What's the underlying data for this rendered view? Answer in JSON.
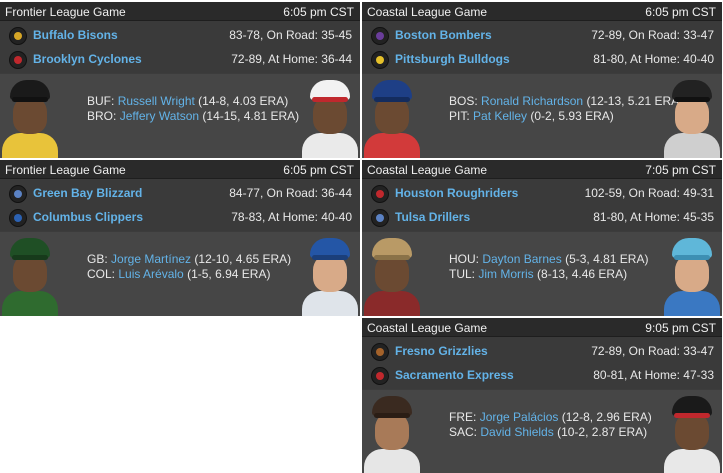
{
  "games": [
    {
      "league": "Frontier League Game",
      "time": "6:05 pm CST",
      "away": {
        "name": "Buffalo Bisons",
        "record": "83-78, On Road: 35-45",
        "logo_icon": "bisons-logo-icon"
      },
      "home": {
        "name": "Brooklyn Cyclones",
        "record": "72-89, At Home: 36-44",
        "logo_icon": "cyclones-logo-icon"
      },
      "away_pitcher": {
        "abbr": "BUF:",
        "name": "Russell Wright",
        "stats": "(14-8, 4.03 ERA)"
      },
      "home_pitcher": {
        "abbr": "BRO:",
        "name": "Jeffery Watson",
        "stats": "(14-15, 4.81 ERA)"
      }
    },
    {
      "league": "Coastal League Game",
      "time": "6:05 pm CST",
      "away": {
        "name": "Boston Bombers",
        "record": "72-89, On Road: 33-47",
        "logo_icon": "bombers-logo-icon"
      },
      "home": {
        "name": "Pittsburgh Bulldogs",
        "record": "81-80, At Home: 40-40",
        "logo_icon": "bulldogs-logo-icon"
      },
      "away_pitcher": {
        "abbr": "BOS:",
        "name": "Ronald Richardson",
        "stats": "(12-13, 5.21 ERA)"
      },
      "home_pitcher": {
        "abbr": "PIT:",
        "name": "Pat Kelley",
        "stats": "(0-2, 5.93 ERA)"
      }
    },
    {
      "league": "Frontier League Game",
      "time": "6:05 pm CST",
      "away": {
        "name": "Green Bay Blizzard",
        "record": "84-77, On Road: 36-44",
        "logo_icon": "blizzard-logo-icon"
      },
      "home": {
        "name": "Columbus Clippers",
        "record": "78-83, At Home: 40-40",
        "logo_icon": "clippers-logo-icon"
      },
      "away_pitcher": {
        "abbr": "GB:",
        "name": "Jorge Martínez",
        "stats": "(12-10, 4.65 ERA)"
      },
      "home_pitcher": {
        "abbr": "COL:",
        "name": "Luis Arévalo",
        "stats": "(1-5, 6.94 ERA)"
      }
    },
    {
      "league": "Coastal League Game",
      "time": "7:05 pm CST",
      "away": {
        "name": "Houston Roughriders",
        "record": "102-59, On Road: 49-31",
        "logo_icon": "roughriders-logo-icon"
      },
      "home": {
        "name": "Tulsa Drillers",
        "record": "81-80, At Home: 45-35",
        "logo_icon": "drillers-logo-icon"
      },
      "away_pitcher": {
        "abbr": "HOU:",
        "name": "Dayton Barnes",
        "stats": "(5-3, 4.81 ERA)"
      },
      "home_pitcher": {
        "abbr": "TUL:",
        "name": "Jim Morris",
        "stats": "(8-13, 4.46 ERA)"
      }
    },
    {
      "league": "Coastal League Game",
      "time": "9:05 pm CST",
      "away": {
        "name": "Fresno Grizzlies",
        "record": "72-89, On Road: 33-47",
        "logo_icon": "grizzlies-logo-icon"
      },
      "home": {
        "name": "Sacramento Express",
        "record": "80-81, At Home: 47-33",
        "logo_icon": "express-logo-icon"
      },
      "away_pitcher": {
        "abbr": "FRE:",
        "name": "Jorge Palácios",
        "stats": "(12-8, 2.96 ERA)"
      },
      "home_pitcher": {
        "abbr": "SAC:",
        "name": "David Shields",
        "stats": "(10-2, 2.87 ERA)"
      }
    }
  ],
  "colors": {
    "card_bg": "#3c3c3c",
    "header_bg": "#2a2a2a",
    "link_blue": "#63b3e8",
    "text": "#e8e8e8"
  }
}
